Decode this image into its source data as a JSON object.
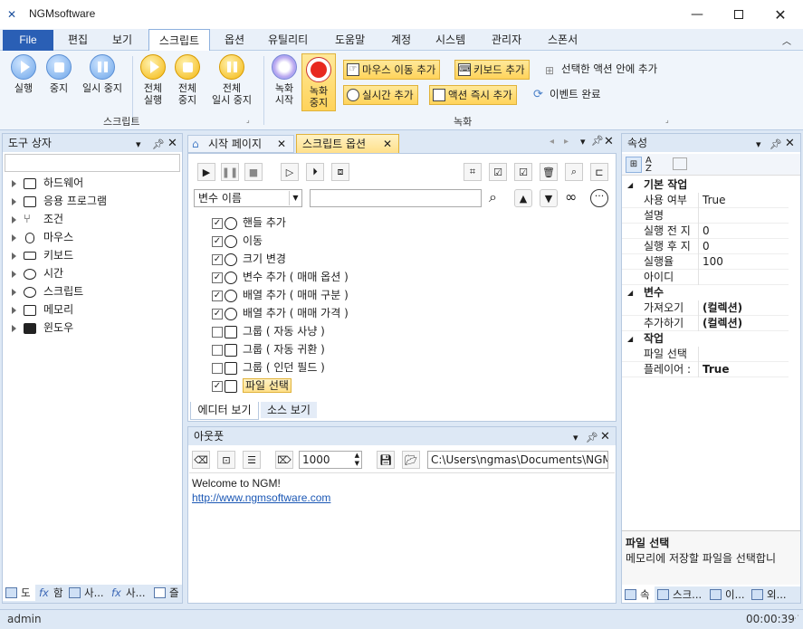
{
  "app": {
    "title": "NGMsoftware"
  },
  "menu": {
    "file": "File",
    "items": [
      "편집",
      "보기",
      "스크립트",
      "옵션",
      "유틸리티",
      "도움말",
      "계정",
      "시스템",
      "관리자",
      "스폰서"
    ]
  },
  "ribbon": {
    "script_group": {
      "label": "스크립트",
      "run": "실행",
      "stop": "중지",
      "pause": "일시 중지",
      "run_all_1": "전체",
      "run_all_2": "실행",
      "stop_all_1": "전체",
      "stop_all_2": "중지",
      "pause_all_1": "전체",
      "pause_all_2": "일시 중지"
    },
    "record_group": {
      "label": "녹화",
      "rec_start_1": "녹화",
      "rec_start_2": "시작",
      "rec_stop_1": "녹화",
      "rec_stop_2": "중지",
      "add_mouse_move": "마우스 이동 추가",
      "add_keyboard": "키보드 추가",
      "add_in_selected": "선택한 액션 안에 추가",
      "add_time": "실시간 추가",
      "action_immediate": "액션 즉시 추가",
      "event_complete": "이벤트 완료"
    }
  },
  "toolbox": {
    "title": "도구 상자",
    "search_value": "",
    "items": [
      "하드웨어",
      "응용 프로그램",
      "조건",
      "마우스",
      "키보드",
      "시간",
      "스크립트",
      "메모리",
      "윈도우"
    ],
    "bottom_tabs": [
      "도",
      "함",
      "사...",
      "사...",
      "즐"
    ]
  },
  "editor": {
    "tabs": [
      "시작 페이지",
      "스크립트 옵션"
    ],
    "var_select": "변수 이름",
    "var_value": "",
    "actions": [
      {
        "label": "핸들 추가",
        "checked": true
      },
      {
        "label": "이동",
        "checked": true
      },
      {
        "label": "크기 변경",
        "checked": true
      },
      {
        "label": "변수 추가 ( 매매 옵션 )",
        "checked": true
      },
      {
        "label": "배열 추가 ( 매매 구분 )",
        "checked": true
      },
      {
        "label": "배열 추가 ( 매매 가격 )",
        "checked": true
      },
      {
        "label": "그룹 ( 자동 사냥 )",
        "checked": false
      },
      {
        "label": "그룹 ( 자동 귀환 )",
        "checked": false
      },
      {
        "label": "그룹 ( 인던 필드 )",
        "checked": false
      },
      {
        "label": "파일 선택",
        "checked": true
      }
    ],
    "view_tabs": [
      "에디터 보기",
      "소스 보기"
    ]
  },
  "output": {
    "title": "아웃풋",
    "count": "1000",
    "path": "C:\\Users\\ngmas\\Documents\\NGM6\\",
    "welcome": "Welcome to NGM!",
    "link": "http://www.ngmsoftware.com"
  },
  "properties": {
    "title": "속성",
    "categories": [
      {
        "name": "기본 작업",
        "rows": [
          {
            "key": "사용 여부",
            "value": "True",
            "bold": false
          },
          {
            "key": "설명",
            "value": "",
            "bold": false
          },
          {
            "key": "실행 전 지",
            "value": "0",
            "bold": false
          },
          {
            "key": "실행 후 지",
            "value": "0",
            "bold": false
          },
          {
            "key": "실행율",
            "value": "100",
            "bold": false
          },
          {
            "key": "아이디",
            "value": "",
            "bold": false
          }
        ]
      },
      {
        "name": "변수",
        "rows": [
          {
            "key": "가져오기",
            "value": "(컬렉션)",
            "bold": true
          },
          {
            "key": "추가하기",
            "value": "(컬렉션)",
            "bold": true
          }
        ]
      },
      {
        "name": "작업",
        "rows": [
          {
            "key": "파일 선택",
            "value": "",
            "bold": false
          },
          {
            "key": "플레이어 :",
            "value": "True",
            "bold": true
          }
        ]
      }
    ],
    "desc_title": "파일 선택",
    "desc_text": "메모리에 저장할 파일을 선택합니",
    "bottom_tabs": [
      "속",
      "스크...",
      "이...",
      "외..."
    ]
  },
  "status": {
    "user": "admin",
    "time": "00:00:39"
  }
}
